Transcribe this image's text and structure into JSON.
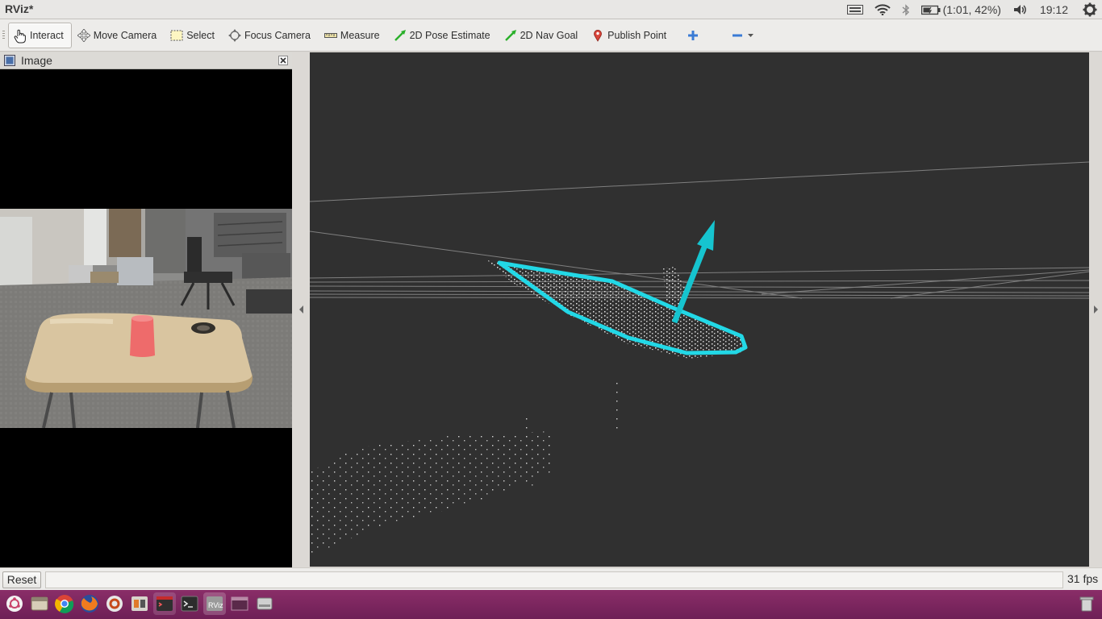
{
  "system": {
    "app_title": "RViz*",
    "battery_label": "(1:01, 42%)",
    "clock": "19:12"
  },
  "toolbar": {
    "tools": [
      {
        "label": "Interact",
        "icon": "hand-pointer-icon",
        "active": true
      },
      {
        "label": "Move Camera",
        "icon": "move-camera-icon"
      },
      {
        "label": "Select",
        "icon": "select-box-icon"
      },
      {
        "label": "Focus Camera",
        "icon": "focus-crosshair-icon"
      },
      {
        "label": "Measure",
        "icon": "ruler-icon"
      },
      {
        "label": "2D Pose Estimate",
        "icon": "green-arrow-icon"
      },
      {
        "label": "2D Nav Goal",
        "icon": "green-arrow-icon"
      },
      {
        "label": "Publish Point",
        "icon": "map-pin-icon"
      }
    ],
    "add_tool_icon": "plus-icon",
    "remove_tool_icon": "minus-icon",
    "dropdown_icon": "chevron-down-icon"
  },
  "image_panel": {
    "title": "Image",
    "close_icon": "close-icon"
  },
  "statusbar": {
    "reset_label": "Reset",
    "fps": "31 fps"
  },
  "colors": {
    "viewport_bg": "#303030",
    "plane_outline": "#22d8e6",
    "normal_arrow": "#16c4cf",
    "taskbar": "#7a2460"
  },
  "launcher": {
    "icons": [
      "ubuntu-dash-icon",
      "files-icon",
      "chrome-icon",
      "firefox-icon",
      "settings-icon",
      "app-icon",
      "terminal-red-icon",
      "terminal-icon",
      "rviz-icon",
      "window-icon",
      "drive-icon",
      "trash-icon"
    ]
  }
}
